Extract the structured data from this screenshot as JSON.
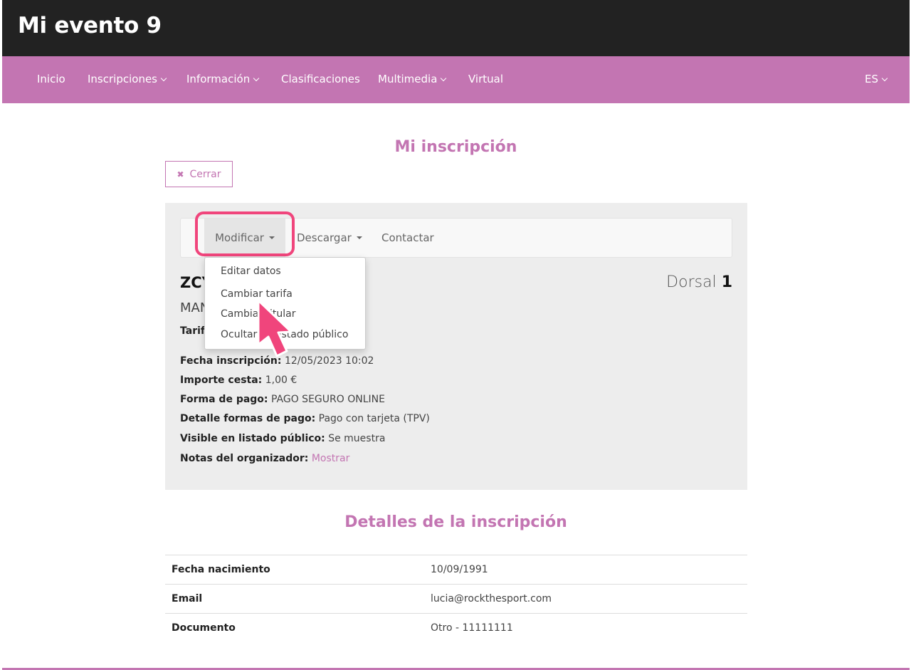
{
  "header": {
    "title": "Mi evento 9"
  },
  "nav": {
    "items": [
      {
        "label": "Inicio",
        "has_dropdown": false
      },
      {
        "label": "Inscripciones",
        "has_dropdown": true
      },
      {
        "label": "Información",
        "has_dropdown": true
      },
      {
        "label": "Clasificaciones",
        "has_dropdown": false
      },
      {
        "label": "Multimedia",
        "has_dropdown": true
      },
      {
        "label": "Virtual",
        "has_dropdown": false
      }
    ],
    "language": "ES"
  },
  "page": {
    "title": "Mi inscripción",
    "close_label": "Cerrar"
  },
  "toolbar": {
    "tabs": [
      {
        "label": "Modificar",
        "active": true
      },
      {
        "label": "Descargar",
        "active": false
      },
      {
        "label": "Contactar",
        "active": false
      }
    ]
  },
  "dropdown": {
    "items": [
      "Editar datos",
      "Cambiar tarifa",
      "Cambiar titular",
      "Ocultar en listado público"
    ]
  },
  "registration": {
    "name": "ZCY",
    "subname": "MAN",
    "tarifa_label": "Tarifa",
    "dorsal_label": "Dorsal",
    "dorsal_number": "1",
    "fields": [
      {
        "label": "Fecha inscripción:",
        "value": "12/05/2023 10:02"
      },
      {
        "label": "Importe cesta:",
        "value": "1,00 €"
      },
      {
        "label": "Forma de pago:",
        "value": "PAGO SEGURO ONLINE"
      },
      {
        "label": "Detalle formas de pago:",
        "value": "Pago con tarjeta (TPV)"
      },
      {
        "label": "Visible en listado público:",
        "value": "Se muestra"
      },
      {
        "label": "Notas del organizador:",
        "value": "Mostrar"
      }
    ]
  },
  "details": {
    "title": "Detalles de la inscripción",
    "rows": [
      {
        "label": "Fecha nacimiento",
        "value": "10/09/1991"
      },
      {
        "label": "Email",
        "value": "lucia@rockthesport.com"
      },
      {
        "label": "Documento",
        "value": "Otro - 11111111"
      }
    ]
  },
  "colors": {
    "brand": "#c375b2",
    "topbar": "#222222",
    "highlight": "#f0457c"
  }
}
